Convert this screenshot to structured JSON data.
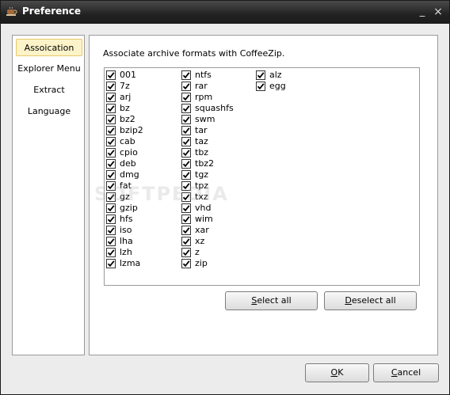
{
  "window": {
    "title": "Preference",
    "minimize_glyph": "_",
    "close_glyph": "×"
  },
  "sidebar": {
    "items": [
      {
        "label": "Assoication",
        "selected": true
      },
      {
        "label": "Explorer Menu",
        "selected": false
      },
      {
        "label": "Extract",
        "selected": false
      },
      {
        "label": "Language",
        "selected": false
      }
    ]
  },
  "association": {
    "description": "Associate archive formats with CoffeeZip.",
    "formats": [
      {
        "label": "001",
        "checked": true
      },
      {
        "label": "7z",
        "checked": true
      },
      {
        "label": "arj",
        "checked": true
      },
      {
        "label": "bz",
        "checked": true
      },
      {
        "label": "bz2",
        "checked": true
      },
      {
        "label": "bzip2",
        "checked": true
      },
      {
        "label": "cab",
        "checked": true
      },
      {
        "label": "cpio",
        "checked": true
      },
      {
        "label": "deb",
        "checked": true
      },
      {
        "label": "dmg",
        "checked": true
      },
      {
        "label": "fat",
        "checked": true
      },
      {
        "label": "gz",
        "checked": true
      },
      {
        "label": "gzip",
        "checked": true
      },
      {
        "label": "hfs",
        "checked": true
      },
      {
        "label": "iso",
        "checked": true
      },
      {
        "label": "lha",
        "checked": true
      },
      {
        "label": "lzh",
        "checked": true
      },
      {
        "label": "lzma",
        "checked": true
      },
      {
        "label": "ntfs",
        "checked": true
      },
      {
        "label": "rar",
        "checked": true
      },
      {
        "label": "rpm",
        "checked": true
      },
      {
        "label": "squashfs",
        "checked": true
      },
      {
        "label": "swm",
        "checked": true
      },
      {
        "label": "tar",
        "checked": true
      },
      {
        "label": "taz",
        "checked": true
      },
      {
        "label": "tbz",
        "checked": true
      },
      {
        "label": "tbz2",
        "checked": true
      },
      {
        "label": "tgz",
        "checked": true
      },
      {
        "label": "tpz",
        "checked": true
      },
      {
        "label": "txz",
        "checked": true
      },
      {
        "label": "vhd",
        "checked": true
      },
      {
        "label": "wim",
        "checked": true
      },
      {
        "label": "xar",
        "checked": true
      },
      {
        "label": "xz",
        "checked": true
      },
      {
        "label": "z",
        "checked": true
      },
      {
        "label": "zip",
        "checked": true
      },
      {
        "label": "alz",
        "checked": true
      },
      {
        "label": "egg",
        "checked": true
      }
    ],
    "select_all": {
      "mnemonic": "S",
      "rest": "elect all"
    },
    "deselect_all": {
      "mnemonic": "D",
      "rest": "eselect all"
    }
  },
  "footer": {
    "ok": {
      "mnemonic": "O",
      "rest": "K"
    },
    "cancel": {
      "mnemonic": "C",
      "rest": "ancel"
    }
  },
  "watermark": "SOFTPEDIA",
  "colors": {
    "titlebar": "#222222",
    "selected_item_bg": "#fdf3c9",
    "selected_item_border": "#e7c86a"
  },
  "icons": {
    "app": "coffee-cup-icon",
    "checkbox": "checkmark-icon"
  }
}
